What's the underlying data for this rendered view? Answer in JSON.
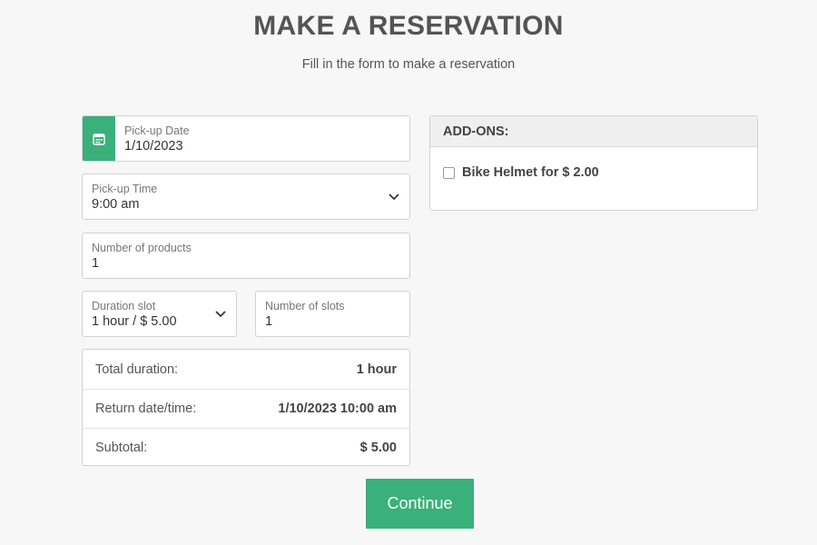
{
  "header": {
    "title": "MAKE A RESERVATION",
    "subtitle": "Fill in the form to make a reservation"
  },
  "form": {
    "pickup_date": {
      "label": "Pick-up Date",
      "value": "1/10/2023",
      "icon": "calendar-icon"
    },
    "pickup_time": {
      "label": "Pick-up Time",
      "value": "9:00 am"
    },
    "num_products": {
      "label": "Number of products",
      "value": "1"
    },
    "duration_slot": {
      "label": "Duration slot",
      "value": "1 hour / $ 5.00"
    },
    "num_slots": {
      "label": "Number of slots",
      "value": "1"
    }
  },
  "summary": {
    "rows": [
      {
        "label": "Total duration:",
        "value": "1 hour"
      },
      {
        "label": "Return date/time:",
        "value": "1/10/2023 10:00 am"
      },
      {
        "label": "Subtotal:",
        "value": "$ 5.00"
      }
    ]
  },
  "addons": {
    "heading": "ADD-ONS:",
    "items": [
      {
        "label": "Bike Helmet for $ 2.00",
        "checked": false
      }
    ]
  },
  "actions": {
    "continue_label": "Continue"
  },
  "colors": {
    "accent": "#3ab07a",
    "background": "#f7f7f7"
  }
}
